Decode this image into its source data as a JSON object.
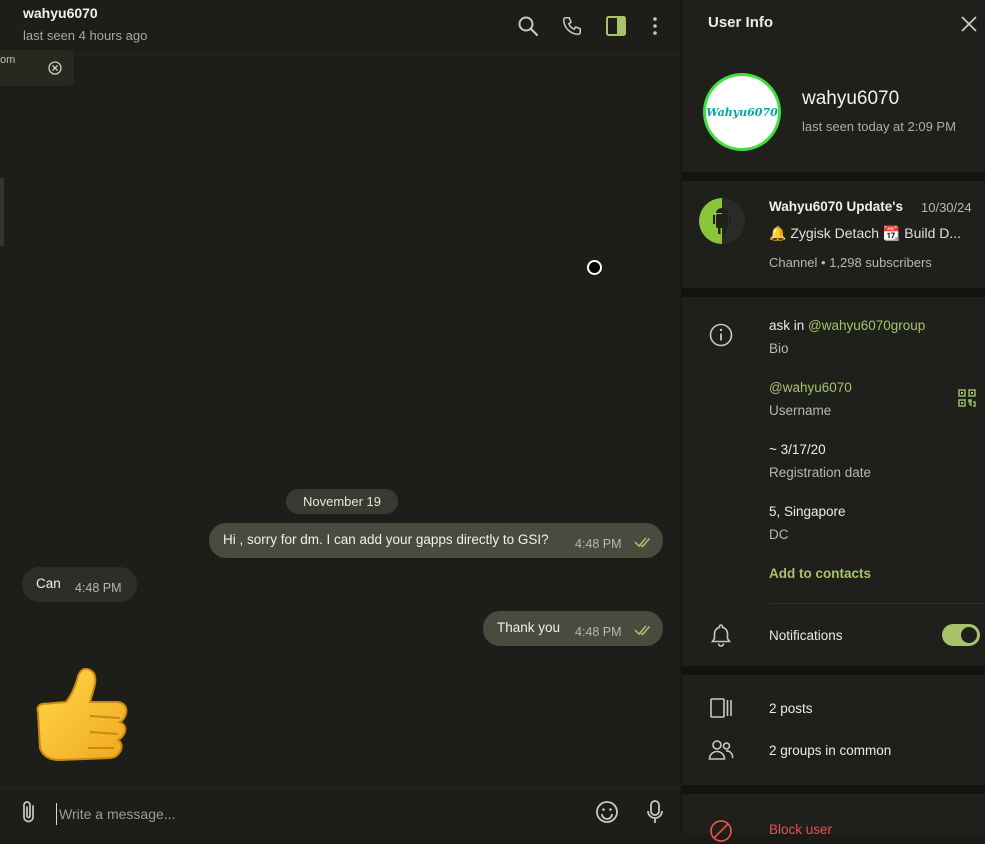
{
  "chat": {
    "peer_name": "wahyu6070",
    "peer_status": "last seen 4 hours ago",
    "toast_text": "om",
    "date_separator": "November 19",
    "messages": [
      {
        "direction": "out",
        "text": "Hi , sorry for dm. I can add your gapps directly to GSI?",
        "time": "4:48 PM",
        "read": true
      },
      {
        "direction": "in",
        "text": "Can",
        "time": "4:48 PM"
      },
      {
        "direction": "out",
        "text": "Thank you",
        "time": "4:48 PM",
        "read": true
      },
      {
        "direction": "in",
        "sticker": "thumbs-up"
      }
    ],
    "composer_placeholder": "Write a message..."
  },
  "info": {
    "title": "User Info",
    "name": "wahyu6070",
    "last_seen": "last seen today at 2:09 PM",
    "avatar_text": "Wahyu6070",
    "channel": {
      "title": "Wahyu6070 Update's",
      "date": "10/30/24",
      "preview": "🔔 Zygisk Detach  📆 Build D...",
      "meta": "Channel • 1,298 subscribers"
    },
    "bio_prefix": "ask in ",
    "bio_link": "@wahyu6070group",
    "bio_label": "Bio",
    "username": "@wahyu6070",
    "username_label": "Username",
    "registration": "~ 3/17/20",
    "registration_label": "Registration date",
    "dc_value": "5, Singapore",
    "dc_label": "DC",
    "add_contacts": "Add to contacts",
    "notifications_label": "Notifications",
    "notifications_on": true,
    "posts": "2 posts",
    "groups": "2 groups in common",
    "block": "Block user"
  },
  "colors": {
    "accent": "#a6c26b",
    "outgoing_bubble": "#4a4b3f",
    "incoming_bubble": "#2d2d29",
    "danger": "#e8504a"
  },
  "icons": [
    "search-icon",
    "phone-icon",
    "sidebar-toggle-icon",
    "more-vertical-icon",
    "close-icon",
    "attach-icon",
    "emoji-icon",
    "microphone-icon",
    "info-icon",
    "qr-code-icon",
    "bell-icon",
    "posts-icon",
    "groups-icon",
    "block-icon",
    "double-check-icon"
  ]
}
